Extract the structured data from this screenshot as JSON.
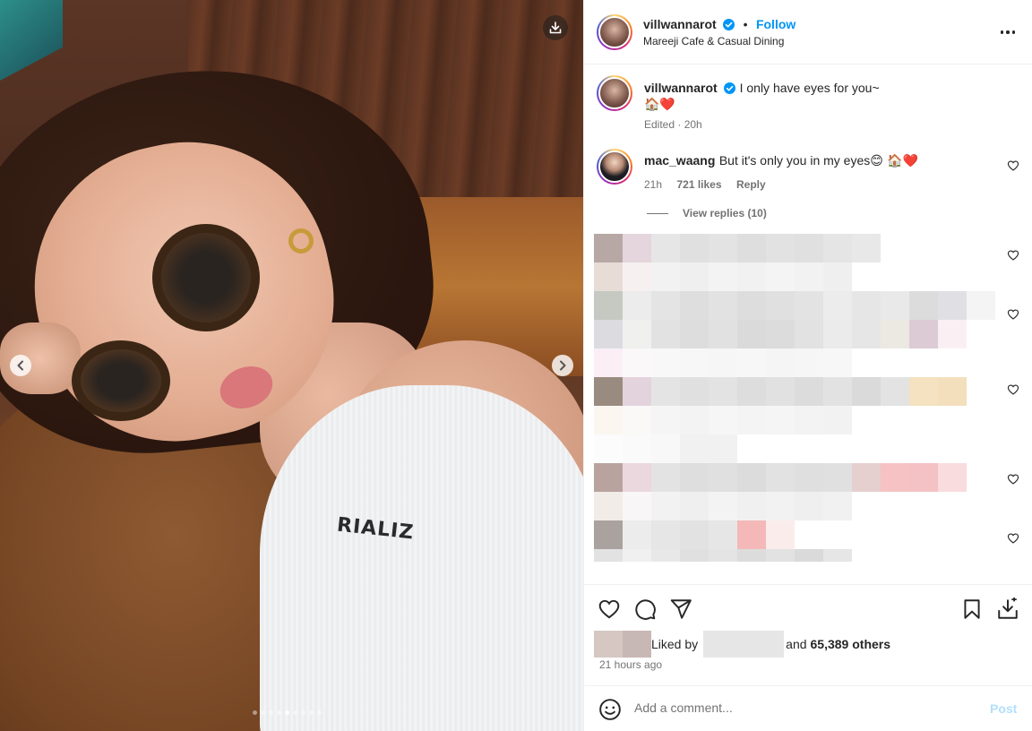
{
  "post": {
    "username": "villwannarot",
    "verified": true,
    "separator": "•",
    "follow_label": "Follow",
    "location": "Mareeji Cafe & Casual Dining",
    "more_icon": "more-horizontal-icon",
    "caption": "I only have eyes for you~",
    "caption_emoji": "🏠❤️",
    "caption_meta": "Edited · 20h",
    "media": {
      "shirt_text": "RIALIZ",
      "slide_index": 5,
      "slide_count": 9,
      "download_icon": "download-icon",
      "prev_icon": "chevron-left-icon",
      "next_icon": "chevron-right-icon"
    }
  },
  "comment": {
    "username": "mac_waang",
    "text": "But it's only you in my eyes",
    "emoji": "😊 🏠❤️",
    "time": "21h",
    "likes": "721 likes",
    "reply_label": "Reply",
    "view_replies": "View replies (10)"
  },
  "actions": {
    "liked_by_prefix": "Liked by",
    "liked_by_conj": "and",
    "liked_by_others": "65,389 others",
    "time_ago": "21 hours ago",
    "comment_placeholder": "Add a comment...",
    "post_label": "Post",
    "icons": [
      "heart-icon",
      "comment-icon",
      "share-icon",
      "bookmark-icon",
      "save-to-collection-icon",
      "emoji-icon"
    ]
  },
  "colors": {
    "accent": "#0095f6",
    "verified": "#0095f6",
    "muted": "#737373",
    "post_disabled": "#b2dffc"
  }
}
